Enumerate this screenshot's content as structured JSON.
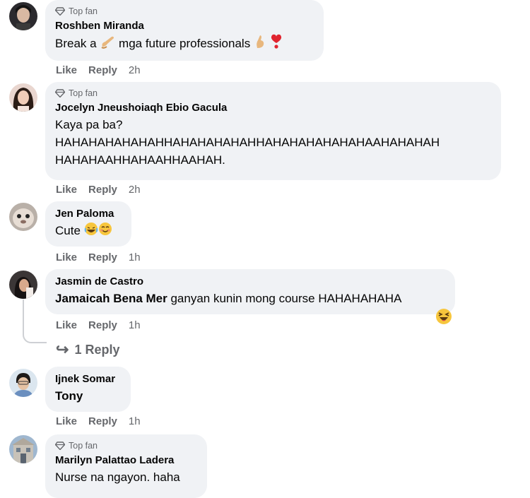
{
  "labels": {
    "top_fan": "Top fan",
    "like": "Like",
    "reply": "Reply"
  },
  "comments": [
    {
      "author": "Roshben Miranda",
      "text_before": "Break a ",
      "text_after": " mga future professionals",
      "time": "2h",
      "badge": true
    },
    {
      "author": "Jocelyn Jneushoiaqh Ebio Gacula",
      "line1": "Kaya pa ba?",
      "line2": "HAHAHAHAHAHAHHAHAHAHAHAHHAHAHAHAHAHAHAAHAHAHAH",
      "line3": "HAHAHAAHHAHAAHHAAHAH.",
      "time": "2h",
      "badge": true
    },
    {
      "author": "Jen Paloma",
      "text": "Cute",
      "time": "1h",
      "badge": false
    },
    {
      "author": "Jasmin de Castro",
      "mention": "Jamaicah Bena Mer",
      "text": " ganyan kunin mong course HAHAHAHAHA",
      "time": "1h",
      "badge": false,
      "replies_label": "1 Reply"
    },
    {
      "author": "Ijnek Somar",
      "text": "Tony",
      "time": "1h",
      "badge": false
    },
    {
      "author": "Marilyn Palattao Ladera",
      "text": "Nurse na ngayon. haha",
      "badge": true
    }
  ],
  "colors": {
    "bubble": "#f0f2f5",
    "secondary_text": "#65676b",
    "primary_text": "#050505"
  },
  "icons": [
    "diamond-icon",
    "leg-emoji",
    "pinched-fingers-emoji",
    "exclamation-heart-emoji",
    "laughing-emoji",
    "smiling-emoji",
    "squinting-laugh-emoji",
    "reply-arrow-icon"
  ]
}
